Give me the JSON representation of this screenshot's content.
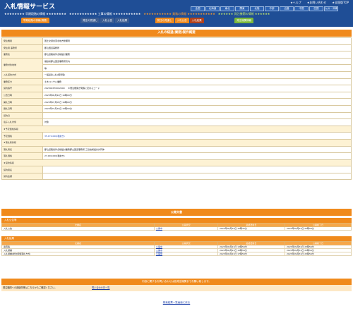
{
  "app": {
    "title": "入札情報サービス",
    "top_links": [
      "★ヘルプ",
      "★お問い合わせ",
      "★全国版TOP"
    ],
    "regions": [
      "全国",
      "北海道",
      "東北",
      "関東",
      "北陸",
      "中部",
      "近畿",
      "中国",
      "四国",
      "九州・沖縄"
    ]
  },
  "categories": [
    {
      "title": "★★★★★★★★ 早期段階の情報 ★★★★★★★★",
      "tabs": [
        "早期段階の情報(概要)"
      ]
    },
    {
      "title": "★★★★★★★★★★★ 工事の情報 ★★★★★★★★★★★",
      "tabs": [
        "発注の見通し",
        "入札公告",
        "入札結果"
      ]
    },
    {
      "title": "★★★★★★★★★★★ 業務の情報 ★★★★★★★★★★★",
      "tabs": [
        "発注の見通し",
        "入札公告",
        "入札結果"
      ]
    },
    {
      "title": "★★★★★★ 発注機関の情報 ★★★★★★",
      "tabs": [
        "発注機関情報"
      ]
    }
  ],
  "page": {
    "title": "入札の経過(業務)案件概要"
  },
  "details": [
    {
      "k": "発注機関",
      "v": "国土交通省東北地方整備局"
    },
    {
      "k": "発注者 事務所",
      "v": "郡山国道事務所"
    },
    {
      "k": "業務名",
      "v": "郡山道路案件点検設計業務"
    },
    {
      "k": "業務対象地域",
      "v": "福島県郡山国道事務所管内",
      "v2": "等"
    },
    {
      "k": "入札契約方式",
      "v": "一般競争入札(標準型)"
    },
    {
      "k": "業務区分",
      "v": "土木コンサル業務"
    },
    {
      "k": "契約番号",
      "v": "202302670002000",
      "note": "★発注機関が発番に定めるコード"
    },
    {
      "k": "公告日時",
      "v": "2023年06月22日 10時00分"
    },
    {
      "k": "開札日時",
      "v": "2023年07月05日 10時00分"
    },
    {
      "k": "開札日時",
      "v": "2023年07月10日 10時00分"
    },
    {
      "k": "契約日",
      "v": ""
    },
    {
      "k": "電子入札対象",
      "v": "対象"
    },
    {
      "sec": "★予定価格情報"
    },
    {
      "k": "予定価格",
      "v": "35,170,000(税抜き)",
      "blue": true
    },
    {
      "sec": "★落札者情報"
    },
    {
      "k": "落札者名",
      "v": "郡山道路案件点検設計業務郡山国道事務所 三協技術設計共同体"
    },
    {
      "k": "落札価格",
      "v": "27,900,000(税抜き)"
    },
    {
      "sec": "★契約情報"
    },
    {
      "k": "契約者名",
      "v": ""
    },
    {
      "k": "契約金額",
      "v": ""
    }
  ],
  "docs": {
    "header": "公開文書",
    "announce": {
      "title": "入札公告等",
      "cols": [
        "文書名",
        "公開状況",
        "最終更新日",
        "公開終了日"
      ],
      "rows": [
        [
          "入札公告",
          "公開中",
          "2023年06月14日 10時35分",
          "2023年09月31日 23時59分"
        ]
      ]
    },
    "bidding": {
      "title": "入札結果",
      "cols": [
        "文書名",
        "公開状況",
        "最終更新日",
        "公開終了日"
      ],
      "rows": [
        [
          "審査等",
          "公開中",
          "2023年06月21日 13時59分",
          "2023年09月31日 23時59分"
        ],
        [
          "入札調書",
          "公開中",
          "2023年06月21日 13時59分",
          "2023年09月31日 23時59分"
        ],
        [
          "入札調書(総合評価落札方式)",
          "公開中",
          "2023年06月21日 17時59分",
          "2023年09月31日 23時59分"
        ]
      ]
    }
  },
  "footer": {
    "bar": "内容に関するお問い合わせは各発注機関までお願い致します。",
    "left": "発注機関への連絡先等はこちらからご確認ください。",
    "link": "問い合わせ先一覧",
    "back": "検索結果一覧画面に戻る"
  }
}
